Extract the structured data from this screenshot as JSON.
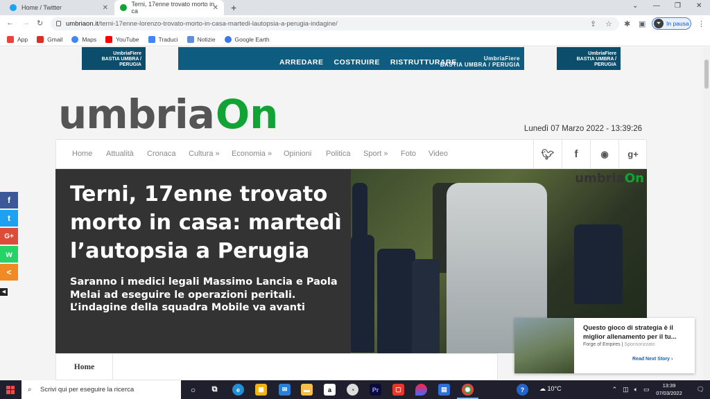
{
  "browser": {
    "tabs": [
      {
        "title": "Home / Twitter",
        "icon": "twitter-icon"
      },
      {
        "title": "Terni, 17enne trovato morto in ca",
        "icon": "umbriaon-icon"
      }
    ],
    "url_host": "umbriaon.it",
    "url_path": "/terni-17enne-lorenzo-trovato-morto-in-casa-martedi-lautopsia-a-perugia-indagine/",
    "profile_status": "In pausa",
    "bookmarks": [
      "App",
      "Gmail",
      "Maps",
      "YouTube",
      "Traduci",
      "Notizie",
      "Google Earth"
    ]
  },
  "ads": {
    "center_words": [
      "ARREDARE",
      "COSTRUIRE",
      "RISTRUTTURARE"
    ],
    "brand": "UmbriaFiere",
    "brand_sub": "BASTIA UMBRA / PERUGIA"
  },
  "site": {
    "logo_word": "umbria",
    "logo_accent": "On",
    "datetime": "Lunedì 07 Marzo 2022 - 13:39:26",
    "menu": [
      "Home",
      "Attualità",
      "Cronaca",
      "Cultura »",
      "Economia »",
      "Opinioni",
      "Politica",
      "Sport »",
      "Foto",
      "Video"
    ],
    "social": [
      "twitter-icon",
      "facebook-icon",
      "rss-icon",
      "google-plus-icon"
    ],
    "subnav_home": "Home"
  },
  "article": {
    "title": "Terni, 17enne trovato morto in casa: martedì l’autopsia a Perugia",
    "subtitle": "Saranno i medici legali Massimo Lancia e Paola Melai ad eseguire le operazioni peritali. L’indagine della squadra Mobile va avanti",
    "watermark": "umbria",
    "watermark_accent": "On"
  },
  "sharebar": [
    {
      "icon": "facebook-icon",
      "glyph": "f",
      "color": "#3b5998"
    },
    {
      "icon": "twitter-icon",
      "glyph": "t",
      "color": "#1da1f2"
    },
    {
      "icon": "google-plus-icon",
      "glyph": "G+",
      "color": "#dd4b39"
    },
    {
      "icon": "whatsapp-icon",
      "glyph": "w",
      "color": "#25d366"
    },
    {
      "icon": "share-icon",
      "glyph": "<",
      "color": "#f08a24"
    }
  ],
  "promo": {
    "title": "Questo gioco di strategia è il miglior allenamento per il tu...",
    "source": "Forge of Empires",
    "sponsored": "Sponsorizzato",
    "cta": "Read Next Story ›"
  },
  "taskbar": {
    "search_placeholder": "Scrivi qui per eseguire la ricerca",
    "weather": "10°C",
    "time": "13:39",
    "date": "07/03/2022"
  }
}
